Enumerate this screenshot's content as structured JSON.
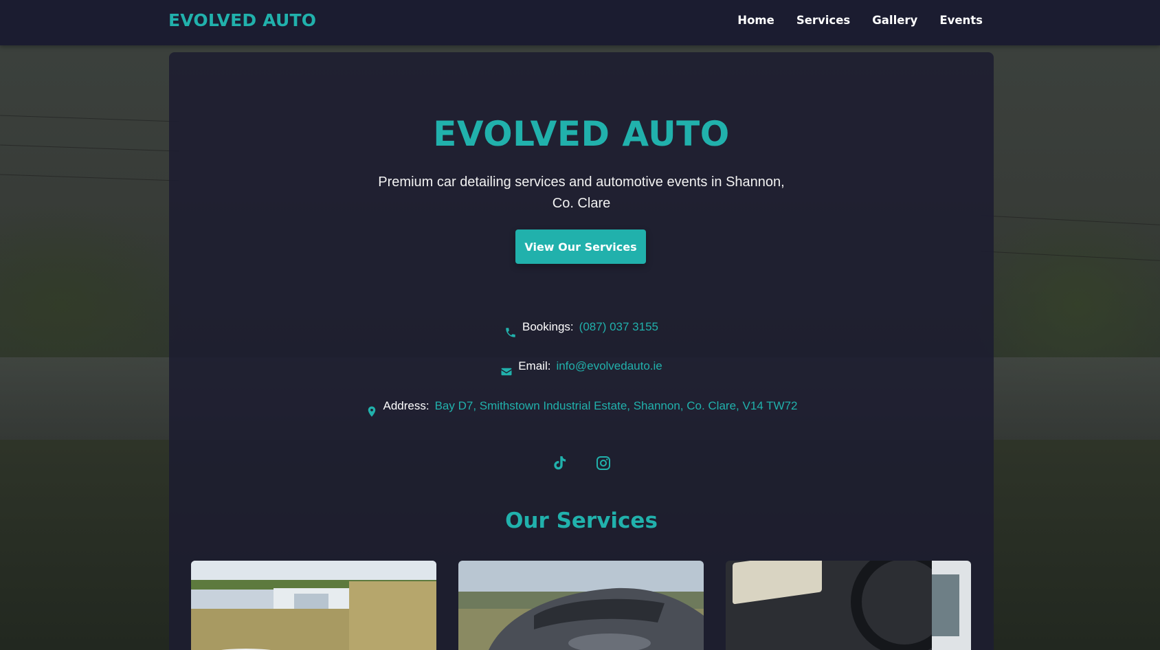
{
  "nav": {
    "brand": "EVOLVED AUTO",
    "links": [
      "Home",
      "Services",
      "Gallery",
      "Events"
    ]
  },
  "hero": {
    "title": "EVOLVED AUTO",
    "subtitle": "Premium car detailing services and automotive events in Shannon, Co. Clare",
    "cta_label": "View Our Services"
  },
  "contact": {
    "bookings_label": "Bookings:",
    "bookings_value": "(087) 037 3155",
    "email_label": "Email:",
    "email_value": "info@evolvedauto.ie",
    "address_label": "Address:",
    "address_value": "Bay D7, Smithstown Industrial Estate, Shannon, Co. Clare, V14 TW72"
  },
  "social": {
    "icons": [
      "tiktok-icon",
      "instagram-icon"
    ]
  },
  "services": {
    "title": "Our Services"
  },
  "colors": {
    "accent": "#21b1ac",
    "nav_bg": "#1b1c30",
    "card_bg": "#1c1d30"
  }
}
